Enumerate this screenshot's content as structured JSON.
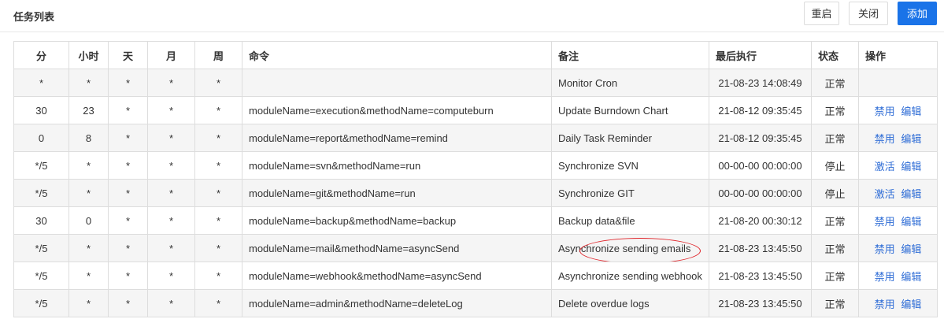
{
  "header": {
    "title": "任务列表",
    "restart_label": "重启",
    "close_label": "关闭",
    "add_label": "添加"
  },
  "table": {
    "columns": {
      "min": "分",
      "hour": "小时",
      "day": "天",
      "month": "月",
      "week": "周",
      "command": "命令",
      "remark": "备注",
      "last_run": "最后执行",
      "status": "状态",
      "actions": "操作"
    },
    "rows": [
      {
        "min": "*",
        "hour": "*",
        "day": "*",
        "month": "*",
        "week": "*",
        "command": "",
        "remark": "Monitor Cron",
        "last_run": "21-08-23 14:08:49",
        "status": "正常",
        "action1": "",
        "action2": ""
      },
      {
        "min": "30",
        "hour": "23",
        "day": "*",
        "month": "*",
        "week": "*",
        "command": "moduleName=execution&methodName=computeburn",
        "remark": "Update Burndown Chart",
        "last_run": "21-08-12 09:35:45",
        "status": "正常",
        "action1": "禁用",
        "action2": "编辑"
      },
      {
        "min": "0",
        "hour": "8",
        "day": "*",
        "month": "*",
        "week": "*",
        "command": "moduleName=report&methodName=remind",
        "remark": "Daily Task Reminder",
        "last_run": "21-08-12 09:35:45",
        "status": "正常",
        "action1": "禁用",
        "action2": "编辑"
      },
      {
        "min": "*/5",
        "hour": "*",
        "day": "*",
        "month": "*",
        "week": "*",
        "command": "moduleName=svn&methodName=run",
        "remark": "Synchronize SVN",
        "last_run": "00-00-00 00:00:00",
        "status": "停止",
        "action1": "激活",
        "action2": "编辑"
      },
      {
        "min": "*/5",
        "hour": "*",
        "day": "*",
        "month": "*",
        "week": "*",
        "command": "moduleName=git&methodName=run",
        "remark": "Synchronize GIT",
        "last_run": "00-00-00 00:00:00",
        "status": "停止",
        "action1": "激活",
        "action2": "编辑"
      },
      {
        "min": "30",
        "hour": "0",
        "day": "*",
        "month": "*",
        "week": "*",
        "command": "moduleName=backup&methodName=backup",
        "remark": "Backup data&file",
        "last_run": "21-08-20 00:30:12",
        "status": "正常",
        "action1": "禁用",
        "action2": "编辑"
      },
      {
        "min": "*/5",
        "hour": "*",
        "day": "*",
        "month": "*",
        "week": "*",
        "command": "moduleName=mail&methodName=asyncSend",
        "remark": "Asynchronize sending emails",
        "last_run": "21-08-23 13:45:50",
        "status": "正常",
        "action1": "禁用",
        "action2": "编辑"
      },
      {
        "min": "*/5",
        "hour": "*",
        "day": "*",
        "month": "*",
        "week": "*",
        "command": "moduleName=webhook&methodName=asyncSend",
        "remark": "Asynchronize sending webhook",
        "last_run": "21-08-23 13:45:50",
        "status": "正常",
        "action1": "禁用",
        "action2": "编辑"
      },
      {
        "min": "*/5",
        "hour": "*",
        "day": "*",
        "month": "*",
        "week": "*",
        "command": "moduleName=admin&methodName=deleteLog",
        "remark": "Delete overdue logs",
        "last_run": "21-08-23 13:45:50",
        "status": "正常",
        "action1": "禁用",
        "action2": "编辑"
      }
    ]
  },
  "colors": {
    "primary": "#1a73e8",
    "link": "#2f6dd6",
    "annotation": "#e0252b",
    "stripe": "#f5f5f5"
  }
}
